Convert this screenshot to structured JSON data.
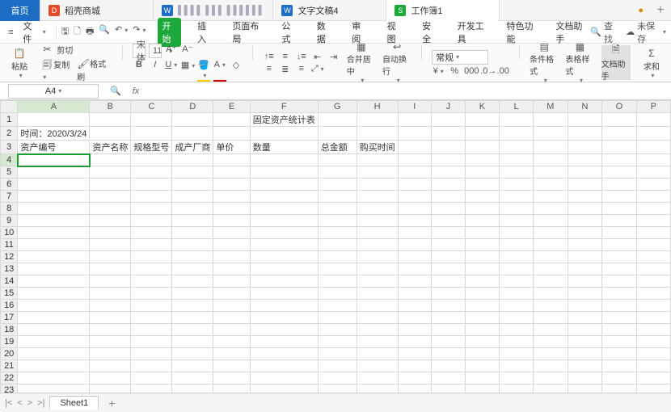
{
  "tabs": {
    "home": "首页",
    "items": [
      {
        "label": "稻壳商城",
        "color": "#e14b2a",
        "active": false
      },
      {
        "label": "▌▌▌▌  ▌▌▌ ▌▌▌▌▌▌",
        "color": "#1d6dc4",
        "active": false,
        "muted": true
      },
      {
        "label": "文字文稿4",
        "color": "#1d6dc4",
        "active": false
      },
      {
        "label": "工作簿1",
        "color": "#1da83a",
        "active": true
      }
    ]
  },
  "menu": {
    "file": "文件",
    "tabs": [
      "开始",
      "插入",
      "页面布局",
      "公式",
      "数据",
      "审阅",
      "视图",
      "安全",
      "开发工具",
      "特色功能",
      "文档助手"
    ],
    "active": 0,
    "find": "查找",
    "unsaved": "未保存"
  },
  "ribbon": {
    "paste": "粘贴",
    "cut": "剪切",
    "copy": "复制",
    "fmt_paint": "格式刷",
    "font_name": "宋体",
    "font_size": "11",
    "merge": "合并居中",
    "wrap": "自动换行",
    "number_format": "常规",
    "cond_fmt": "条件格式",
    "table_style": "表格样式",
    "doc_helper": "文档助手",
    "sum": "求和"
  },
  "cellref": "A4",
  "sheet": {
    "cols": [
      "A",
      "B",
      "C",
      "D",
      "E",
      "F",
      "G",
      "H",
      "I",
      "J",
      "K",
      "L",
      "M",
      "N",
      "O",
      "P"
    ],
    "rows": 23,
    "grid": {
      "r1_title": "固定资产统计表",
      "r2_a": "时间：2020/3/24",
      "r3": [
        "资产编号",
        "资产名称",
        "规格型号",
        "成产厂商",
        "单价",
        "数量",
        "总金额",
        "购买时间"
      ]
    },
    "selected": {
      "row": 4,
      "col": "A"
    },
    "tabs": [
      "Sheet1"
    ]
  }
}
